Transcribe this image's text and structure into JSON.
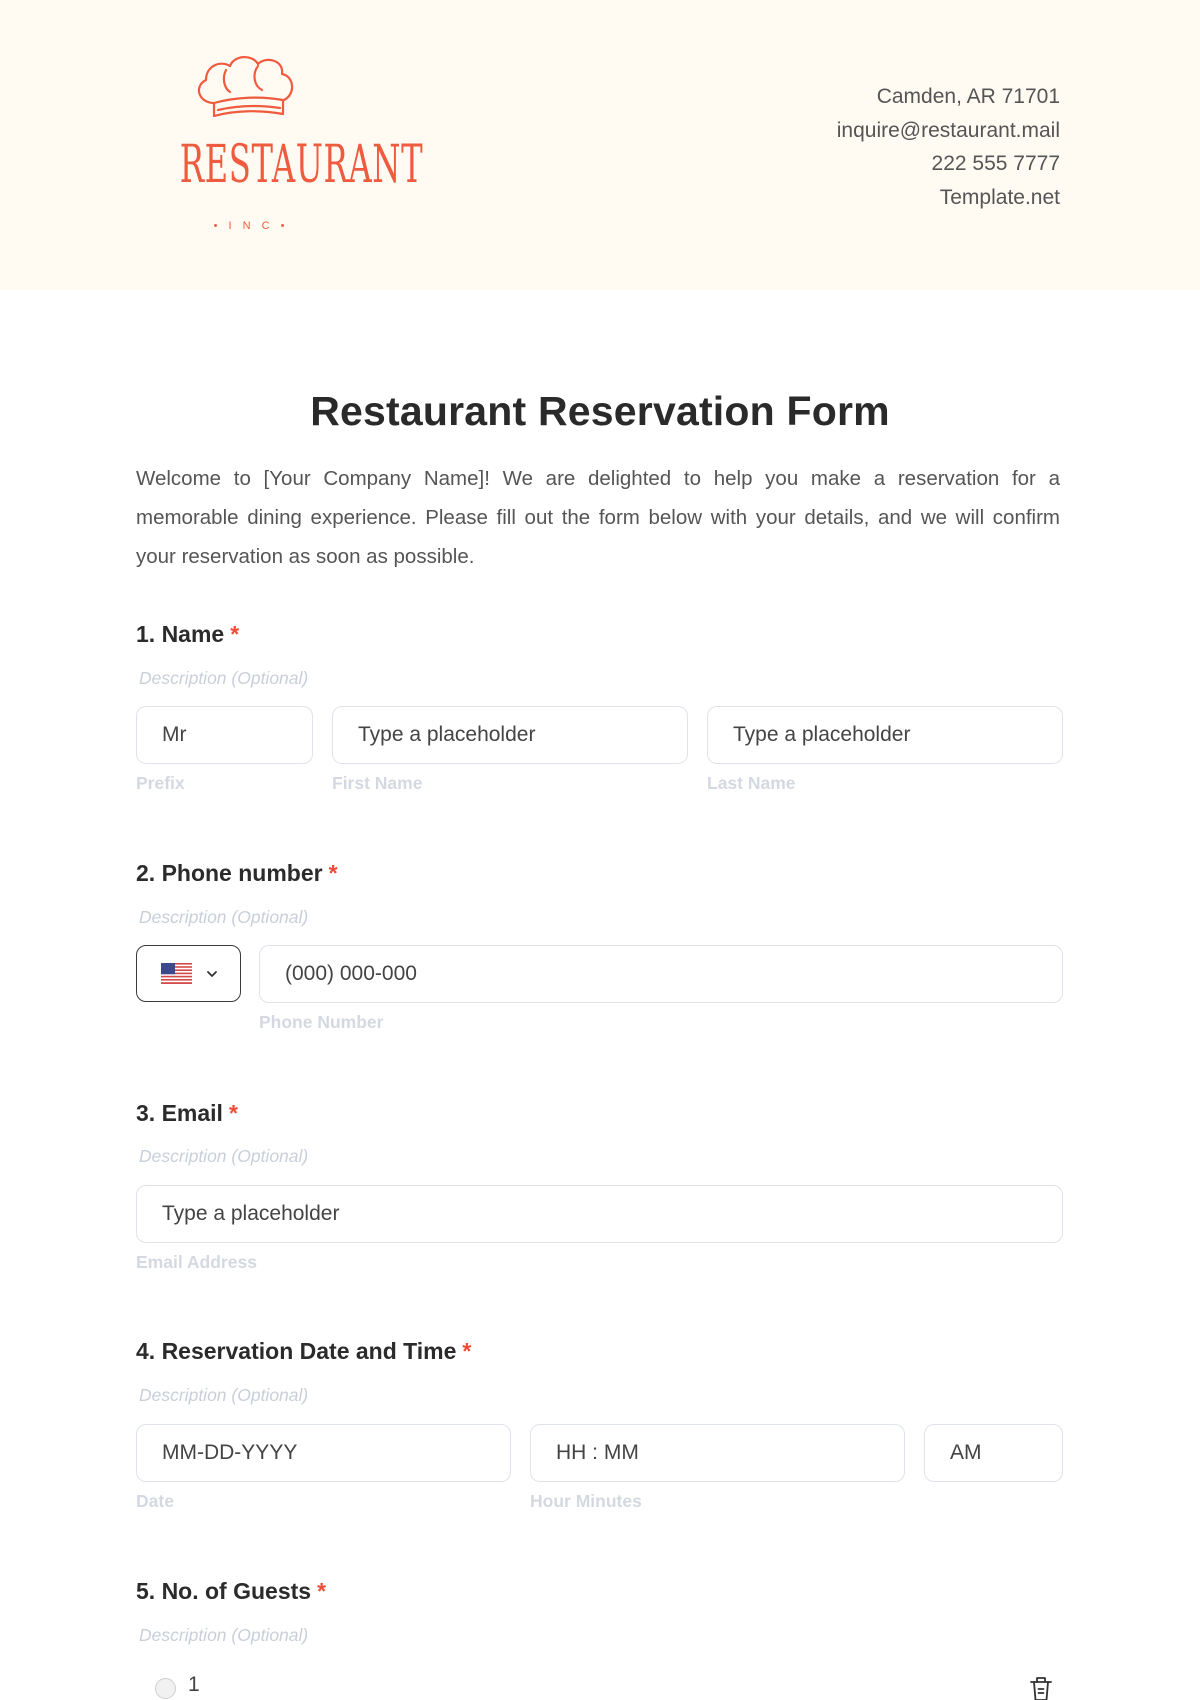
{
  "header": {
    "logo": {
      "brand": "RESTAURANT",
      "sub": "• I N C •",
      "icon": "chef-hat-icon",
      "color": "#ef5b3f"
    },
    "contact": {
      "address": "Camden, AR 71701",
      "email": "inquire@restaurant.mail",
      "phone": "222 555 7777",
      "website": "Template.net"
    }
  },
  "form": {
    "title": "Restaurant Reservation Form",
    "intro": "Welcome to [Your Company Name]! We are delighted to help you make a reservation for a memorable dining experience. Please fill out the form below with your details, and we will confirm your reservation as soon as possible.",
    "required_marker": "*",
    "description_placeholder": "Description (Optional)",
    "questions": {
      "name": {
        "label": "1. Name",
        "prefix": {
          "value": "Mr",
          "sublabel": "Prefix"
        },
        "first": {
          "placeholder": "Type a placeholder",
          "sublabel": "First Name"
        },
        "last": {
          "placeholder": "Type a placeholder",
          "sublabel": "Last Name"
        }
      },
      "phone": {
        "label": "2. Phone number",
        "country_icon": "us-flag-icon",
        "placeholder": "(000) 000-000",
        "sublabel": "Phone Number"
      },
      "email": {
        "label": "3. Email",
        "placeholder": "Type a placeholder",
        "sublabel": "Email Address"
      },
      "datetime": {
        "label": "4. Reservation Date and Time",
        "date": {
          "placeholder": "MM-DD-YYYY",
          "sublabel": "Date"
        },
        "time": {
          "placeholder": "HH : MM",
          "sublabel": "Hour Minutes"
        },
        "ampm": {
          "value": "AM"
        }
      },
      "guests": {
        "label": "5. No. of Guests",
        "options": [
          {
            "label": "1"
          }
        ]
      }
    }
  }
}
